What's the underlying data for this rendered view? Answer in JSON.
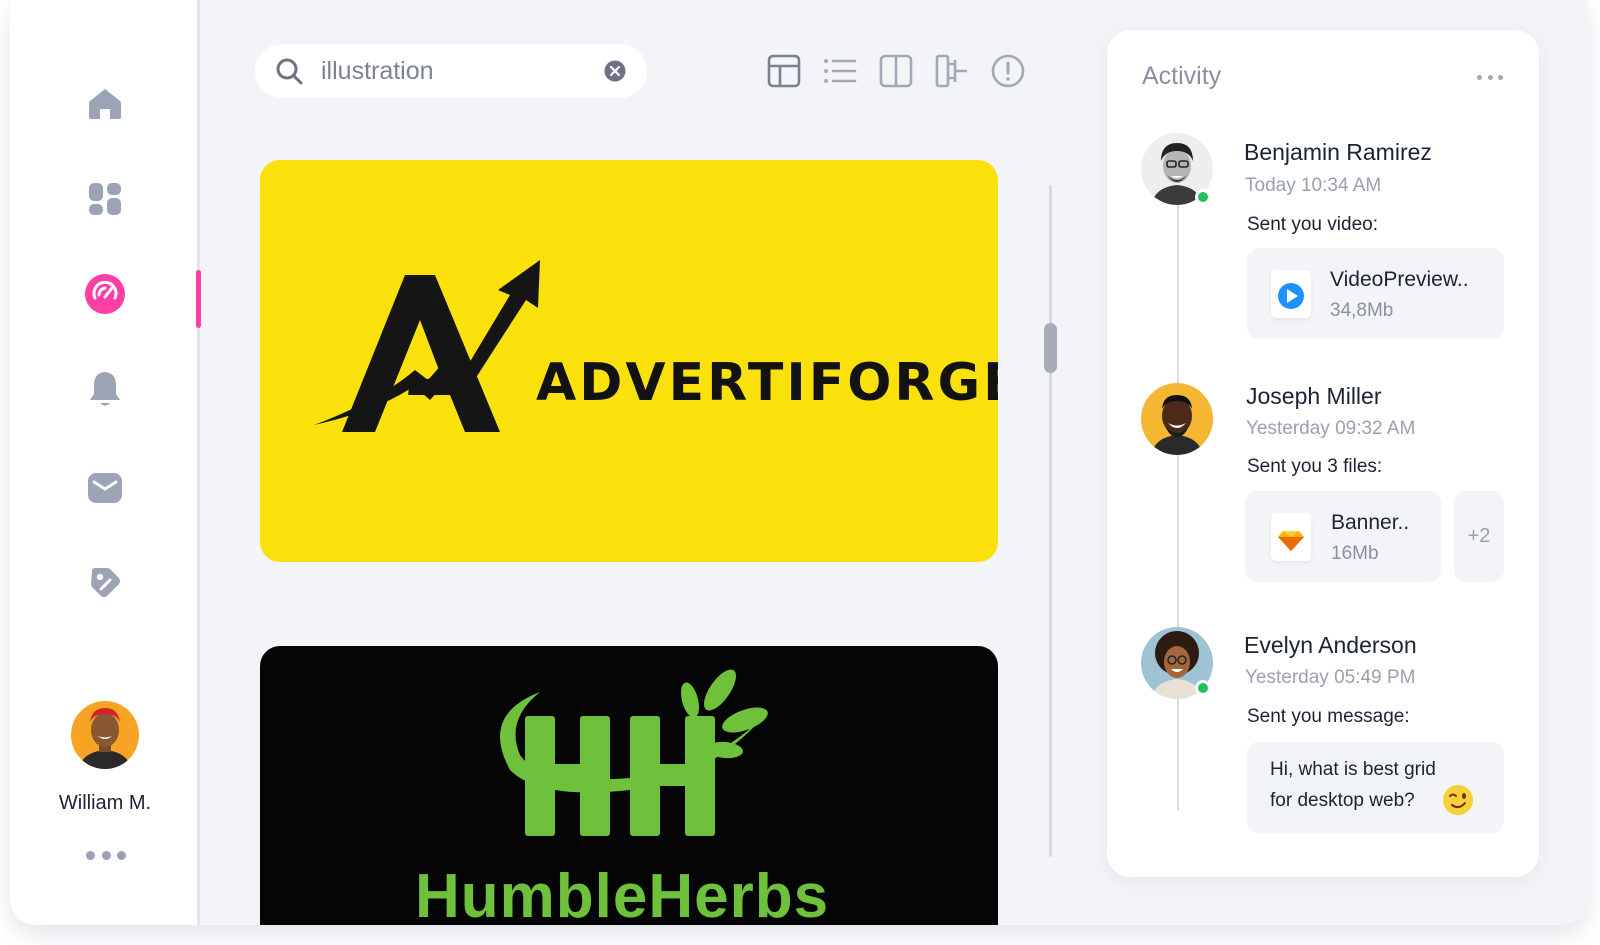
{
  "sidebar": {
    "items": [
      {
        "name": "home",
        "icon": "home-icon"
      },
      {
        "name": "dashboard",
        "icon": "dashboard-icon"
      },
      {
        "name": "analytics",
        "icon": "gauge-icon",
        "active": true
      },
      {
        "name": "notifications",
        "icon": "bell-icon"
      },
      {
        "name": "messages",
        "icon": "mail-icon"
      },
      {
        "name": "tags",
        "icon": "tag-icon"
      }
    ],
    "accent_color": "#ff3fa4",
    "user": {
      "name": "William M."
    }
  },
  "search": {
    "value": "illustration",
    "placeholder": "Search"
  },
  "toolbar": {
    "view_icons": [
      "table-layout-icon",
      "list-view-icon",
      "split-view-icon",
      "hierarchy-icon",
      "info-icon"
    ]
  },
  "gallery": {
    "cards": [
      {
        "brand": "ADVERTIFORGE",
        "background": "#fbe10b"
      },
      {
        "brand": "HumbleHerbs",
        "background": "#050505"
      }
    ]
  },
  "activity": {
    "title": "Activity",
    "entries": [
      {
        "name": "Benjamin Ramirez",
        "time": "Today 10:34 AM",
        "message": "Sent you video:",
        "online": true,
        "file": {
          "name": "VideoPreview..",
          "size": "34,8Mb",
          "icon": "play-icon"
        }
      },
      {
        "name": "Joseph Miller",
        "time": "Yesterday 09:32 AM",
        "message": "Sent you 3 files:",
        "online": false,
        "file": {
          "name": "Banner..",
          "size": "16Mb",
          "icon": "sketch-icon"
        },
        "more": "+2"
      },
      {
        "name": "Evelyn Anderson",
        "time": "Yesterday 05:49 PM",
        "message": "Sent you message:",
        "online": true,
        "text_line1": "Hi, what is best grid",
        "text_line2": "for desktop web?"
      }
    ]
  }
}
